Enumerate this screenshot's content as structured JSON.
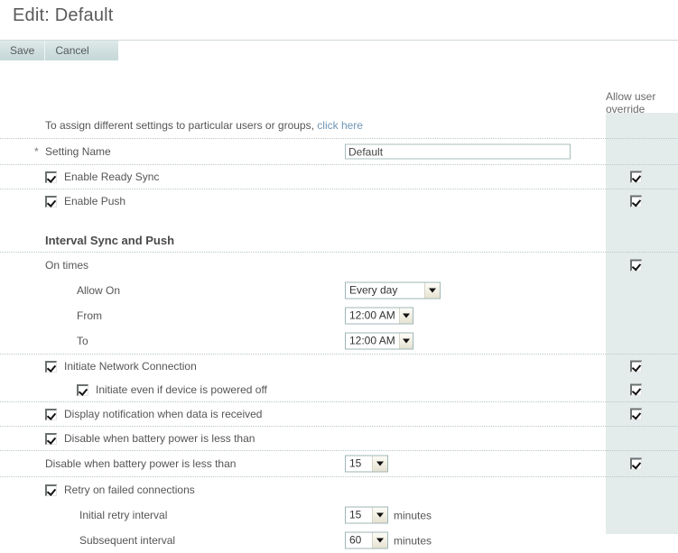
{
  "page": {
    "title": "Edit: Default"
  },
  "toolbar": {
    "save_label": "Save",
    "cancel_label": "Cancel"
  },
  "columns": {
    "allow_user_override": "Allow user override"
  },
  "colors": {
    "link": "#6e95b5",
    "override_column_bg": "#e4ebeb",
    "toolbar_bg": "#cfdede",
    "row_divider": "#b9c6c6"
  },
  "form": {
    "assign_note_text": "To assign different settings to particular users or groups,",
    "assign_note_link": "click here",
    "setting_name_label": "Setting Name",
    "setting_name_value": "Default",
    "setting_name_required_marker": "*",
    "enable_ready_sync_label": "Enable Ready Sync",
    "enable_ready_sync_checked": true,
    "enable_ready_sync_override_checked": true,
    "enable_push_label": "Enable Push",
    "enable_push_checked": true,
    "enable_push_override_checked": true,
    "section_interval_label": "Interval Sync and Push",
    "on_times_label": "On times",
    "on_times_override_checked": true,
    "allow_on_label": "Allow On",
    "allow_on_value": "Every day",
    "from_label": "From",
    "from_value": "12:00 AM",
    "to_label": "To",
    "to_value": "12:00 AM",
    "initiate_network_label": "Initiate Network Connection",
    "initiate_network_checked": true,
    "initiate_network_override_checked": true,
    "initiate_powered_off_label": "Initiate even if device is powered off",
    "initiate_powered_off_checked": true,
    "initiate_powered_off_override_checked": true,
    "display_notification_label": "Display notification when data is received",
    "display_notification_checked": true,
    "display_notification_override_checked": true,
    "disable_battery_cb_label": "Disable when battery power is less than",
    "disable_battery_cb_checked": true,
    "disable_battery_value_label": "Disable when battery power is less than",
    "disable_battery_value": "15",
    "disable_battery_override_checked": true,
    "retry_failed_label": "Retry on failed connections",
    "retry_failed_checked": true,
    "initial_retry_label": "Initial retry interval",
    "initial_retry_value": "15",
    "initial_retry_unit": "minutes",
    "subsequent_interval_label": "Subsequent interval",
    "subsequent_interval_value": "60",
    "subsequent_interval_unit": "minutes"
  }
}
